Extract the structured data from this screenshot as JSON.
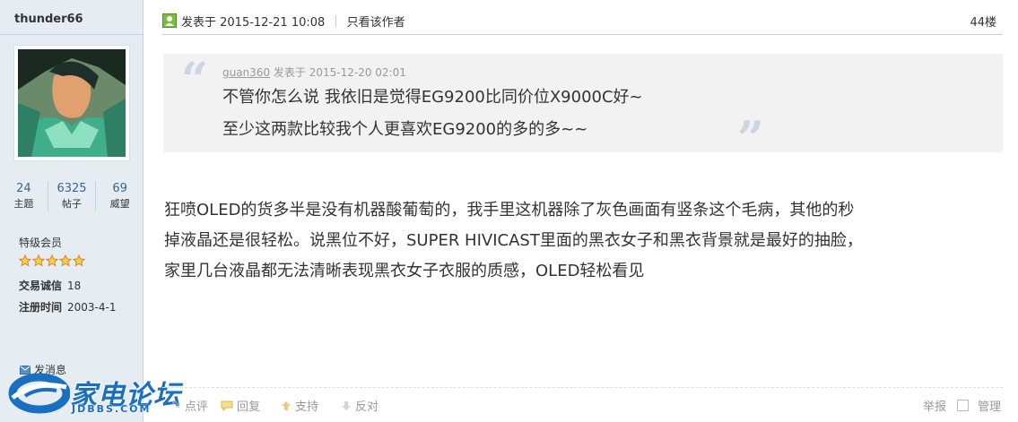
{
  "user": {
    "name": "thunder66",
    "stats": [
      {
        "value": "24",
        "label": "主题"
      },
      {
        "value": "6325",
        "label": "帖子"
      },
      {
        "value": "69",
        "label": "威望"
      }
    ],
    "level": "特级会员",
    "star_count": 5,
    "trade_label": "交易诚信",
    "trade_value": "18",
    "register_label": "注册时间",
    "register_value": "2003-4-1",
    "pm_label": "发消息"
  },
  "logo": {
    "brand": "家电论坛",
    "domain": "JDBBS.COM"
  },
  "post": {
    "posted_label": "发表于 2015-12-21 10:08",
    "only_author": "只看该作者",
    "floor": "44楼",
    "quote": {
      "author": "guan360",
      "meta": "发表于 2015-12-20 02:01",
      "line1": "不管你怎么说 我依旧是觉得EG9200比同价位X9000C好~",
      "line2": "至少这两款比较我个人更喜欢EG9200的多的多~~"
    },
    "body": [
      "狂喷OLED的货多半是没有机器酸葡萄的，我手里这机器除了灰色画面有竖条这个毛病，其他的秒",
      "掉液晶还是很轻松。说黑位不好，SUPER HIVICAST里面的黑衣女子和黑衣背景就是最好的抽脸，",
      "家里几台液晶都无法清晰表现黑衣女子衣服的质感，OLED轻松看见"
    ]
  },
  "actions": {
    "rate": "点评",
    "reply": "回复",
    "support": "支持",
    "oppose": "反对",
    "report": "举报",
    "manage": "管理"
  },
  "colors": {
    "accent": "#369",
    "sidebar_bg": "#e5edf2",
    "quote_bg": "#f2f2f2"
  }
}
